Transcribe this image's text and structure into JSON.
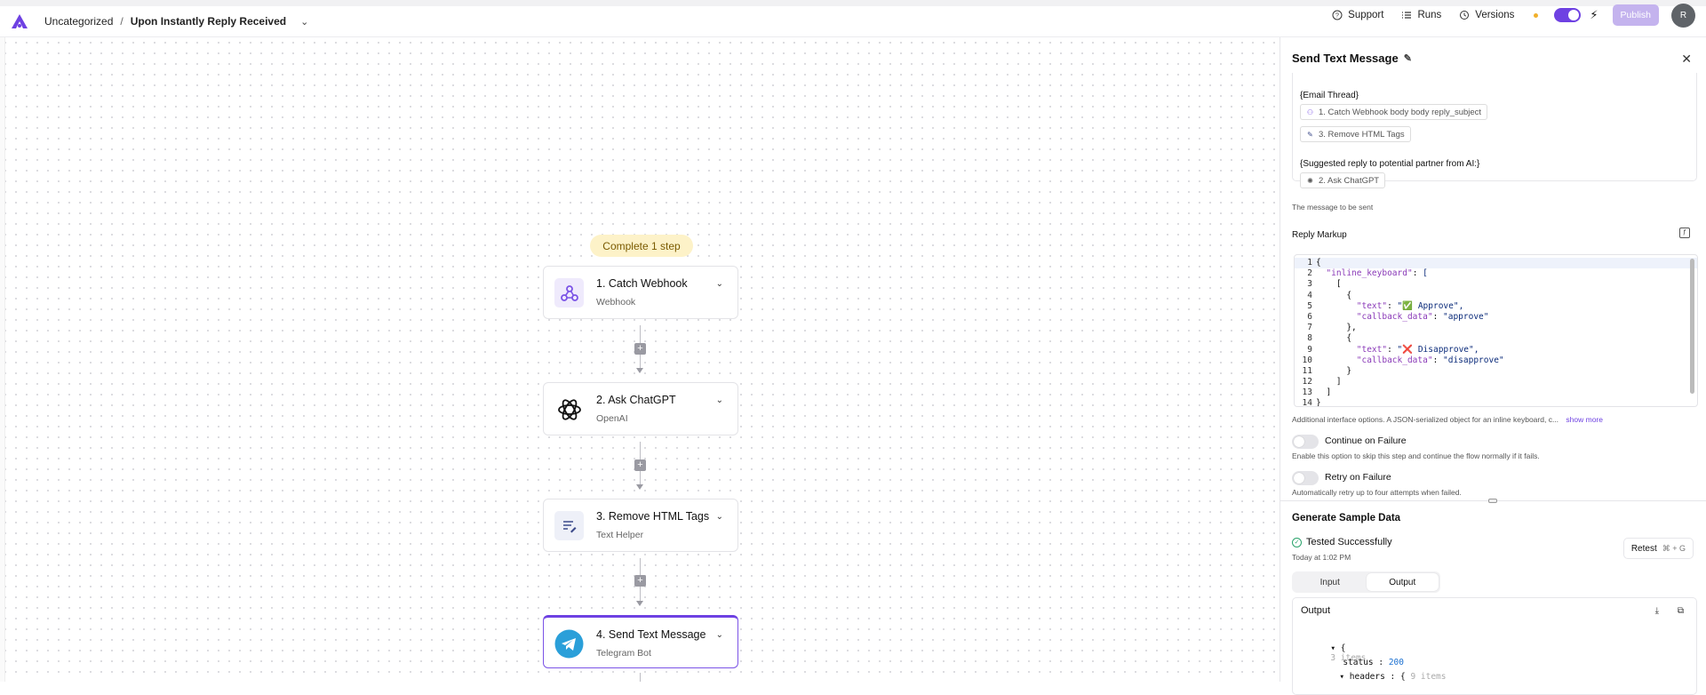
{
  "header": {
    "breadcrumb_folder": "Uncategorized",
    "breadcrumb_separator": "/",
    "flow_name": "Upon Instantly Reply Received",
    "support_label": "Support",
    "runs_label": "Runs",
    "versions_label": "Versions",
    "publish_label": "Publish",
    "avatar_initial": "R"
  },
  "canvas": {
    "complete_pill": "Complete 1 step",
    "steps": [
      {
        "title": "1. Catch Webhook",
        "subtitle": "Webhook"
      },
      {
        "title": "2. Ask ChatGPT",
        "subtitle": "OpenAI"
      },
      {
        "title": "3. Remove HTML Tags",
        "subtitle": "Text Helper"
      },
      {
        "title": "4. Send Text Message",
        "subtitle": "Telegram Bot"
      }
    ]
  },
  "panel": {
    "title": "Send Text Message",
    "message_lines": {
      "email_thread": "{Email Thread}",
      "chip1": "1. Catch Webhook body body reply_subject",
      "chip2": "3. Remove HTML Tags",
      "suggested": "{Suggested reply to potential partner from AI:}",
      "chip3": "2. Ask ChatGPT"
    },
    "message_hint": "The message to be sent",
    "reply_markup_label": "Reply Markup",
    "code_lines": [
      "{",
      "  \"inline_keyboard\": [",
      "    [",
      "      {",
      "        \"text\": \"✅ Approve\",",
      "        \"callback_data\": \"approve\"",
      "      },",
      "      {",
      "        \"text\": \"❌ Disapprove\",",
      "        \"callback_data\": \"disapprove\"",
      "      }",
      "    ]",
      "  ]",
      "}"
    ],
    "reply_markup_hint": "Additional interface options. A JSON-serialized object for an inline keyboard, c...",
    "show_more": "show more",
    "continue_on_failure": "Continue on Failure",
    "continue_hint": "Enable this option to skip this step and continue the flow normally if it fails.",
    "retry_on_failure": "Retry on Failure",
    "retry_hint": "Automatically retry up to four attempts when failed.",
    "generate_title": "Generate Sample Data",
    "tested_label": "Tested Successfully",
    "tested_time": "Today at 1:02 PM",
    "retest_label": "Retest",
    "retest_kbd": "⌘ + G",
    "tab_input": "Input",
    "tab_output": "Output",
    "output_title": "Output",
    "json": {
      "root_hint": "3 items",
      "status_key": "status",
      "status_val": "200",
      "headers_key": "headers",
      "headers_hint": "9 items"
    }
  },
  "colors": {
    "accent": "#6e41e2",
    "pill_bg": "#fdf2c8",
    "success": "#2aa36b"
  }
}
